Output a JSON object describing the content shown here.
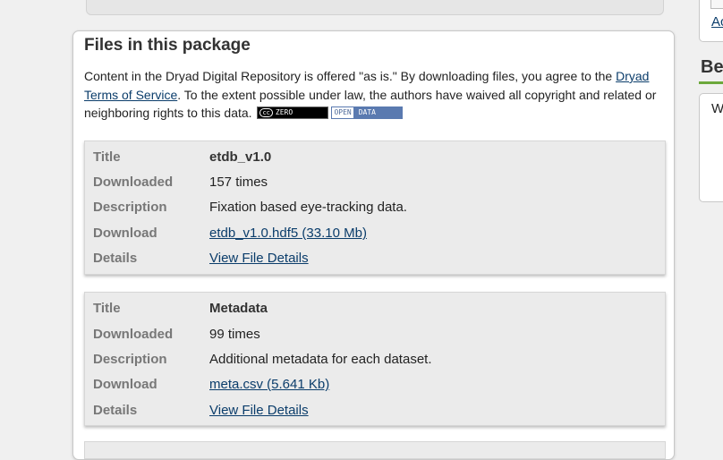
{
  "panel": {
    "title": "Files in this package",
    "notice_part1": "Content in the Dryad Digital Repository is offered \"as is.\" By downloading files, you agree to the ",
    "terms_link": "Dryad Terms of Service",
    "notice_part2": ". To the extent possible under law, the authors have waived all copyright and related or neighboring rights to this data.",
    "cc_badge": "ZERO",
    "cc_mark": "cc",
    "opendata_badge_a": "OPEN",
    "opendata_badge_b": "DATA"
  },
  "files": [
    {
      "title_label": "Title",
      "title": "etdb_v1.0",
      "downloaded_label": "Downloaded",
      "downloaded": "157 times",
      "description_label": "Description",
      "description": "Fixation based eye-tracking data.",
      "download_label": "Download",
      "download": "etdb_v1.0.hdf5 (33.10 Mb)",
      "details_label": "Details",
      "details": "View File Details"
    },
    {
      "title_label": "Title",
      "title": "Metadata",
      "downloaded_label": "Downloaded",
      "downloaded": "99 times",
      "description_label": "Description",
      "description": "Additional metadata for each dataset.",
      "download_label": "Download",
      "download": "meta.csv (5.641 Kb)",
      "details_label": "Details",
      "details": "View File Details"
    }
  ],
  "sidebar": {
    "link_partial": "Ac",
    "heading_partial": "Be",
    "box_text_partial": "W"
  },
  "colors": {
    "link": "#0b3d6b",
    "accent_green": "#6ca83c"
  }
}
